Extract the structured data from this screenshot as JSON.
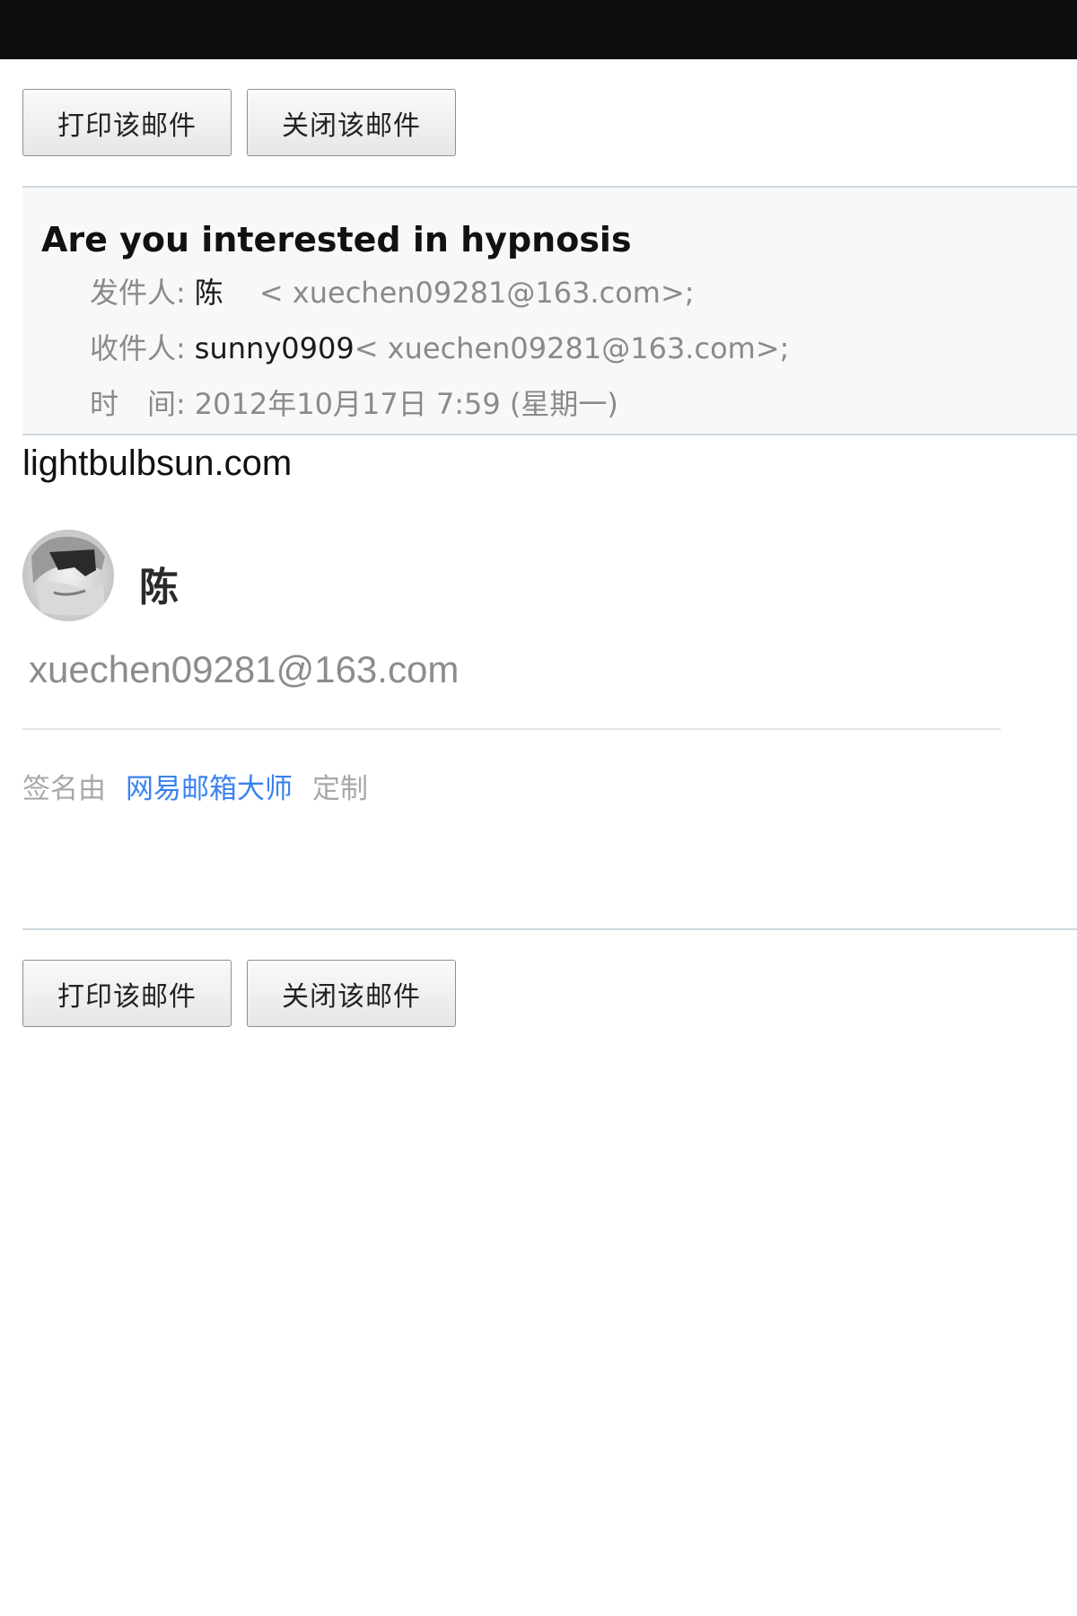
{
  "toolbar": {
    "print_label": "打印该邮件",
    "close_label": "关闭该邮件"
  },
  "email": {
    "subject": "Are you interested in hypnosis",
    "from_label": "发件人:",
    "from_name": "陈",
    "from_address": "< xuechen09281@163.com>;",
    "to_label": "收件人:",
    "to_name": "sunny0909",
    "to_address": "< xuechen09281@163.com>;",
    "time_label": "时　间:",
    "time_value": "2012年10月17日 7:59 (星期一)",
    "body": "lightbulbsun.com"
  },
  "signature": {
    "name": "陈",
    "email": "xuechen09281@163.com",
    "credit_prefix": "签名由",
    "credit_link": "网易邮箱大师",
    "credit_suffix": "定制"
  },
  "colors": {
    "top_bar": "#0d0d0d",
    "header_background": "#f7f8f9",
    "link": "#3b82f0",
    "muted_text": "#8a8a8a"
  },
  "icons": {
    "avatar": "sunglasses-avatar-icon"
  }
}
